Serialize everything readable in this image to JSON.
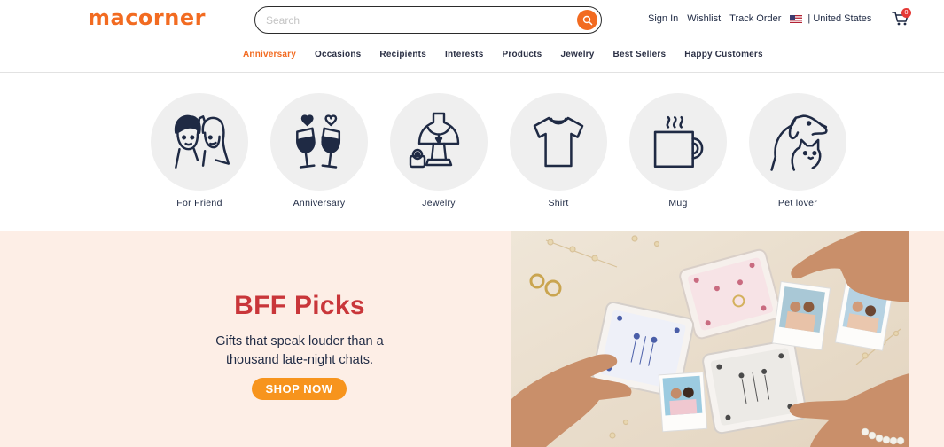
{
  "header": {
    "logo": "macorner",
    "search": {
      "placeholder": "Search"
    },
    "links": {
      "sign_in": "Sign In",
      "wishlist": "Wishlist",
      "track_order": "Track Order",
      "country": "| United States"
    },
    "cart": {
      "count": "0"
    }
  },
  "nav": {
    "items": [
      "Anniversary",
      "Occasions",
      "Recipients",
      "Interests",
      "Products",
      "Jewelry",
      "Best Sellers",
      "Happy Customers"
    ],
    "active_index": 0
  },
  "categories": [
    {
      "label": "For Friend",
      "icon": "friends-icon"
    },
    {
      "label": "Anniversary",
      "icon": "wine-glasses-icon"
    },
    {
      "label": "Jewelry",
      "icon": "necklace-bust-icon"
    },
    {
      "label": "Shirt",
      "icon": "tshirt-icon"
    },
    {
      "label": "Mug",
      "icon": "mug-icon"
    },
    {
      "label": "Pet lover",
      "icon": "dog-cat-icon"
    }
  ],
  "banner": {
    "title": "BFF Picks",
    "subtitle": "Gifts that speak louder than a thousand late-night chats.",
    "cta": "SHOP NOW"
  },
  "colors": {
    "brand": "#f26b21",
    "cta": "#f7941d",
    "title": "#c9363a",
    "banner_bg": "#fdeee6",
    "ink": "#1f2a44"
  }
}
